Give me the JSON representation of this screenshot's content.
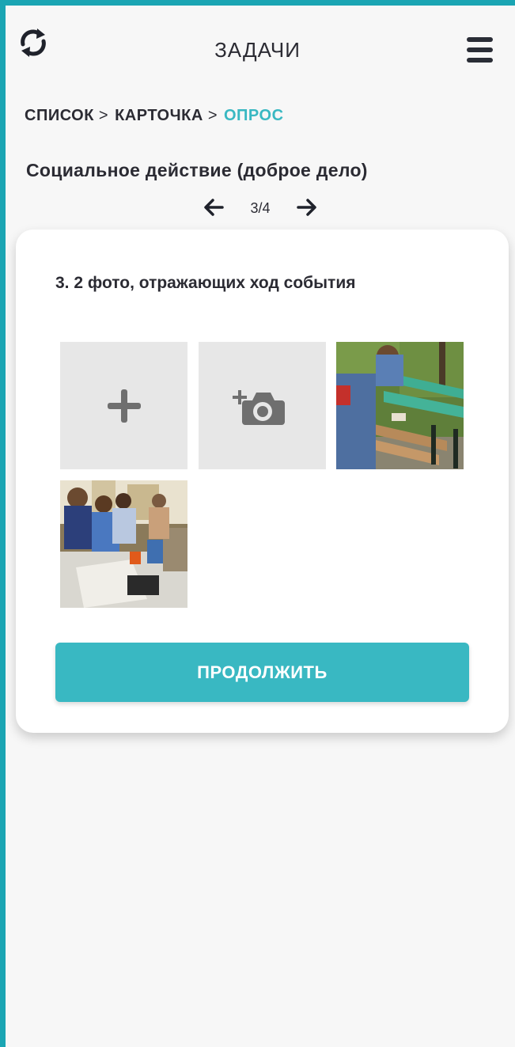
{
  "colors": {
    "accent": "#39b8c2",
    "frame": "#1aa5b3",
    "text": "#2b2b33",
    "background": "#f7f7f7"
  },
  "header": {
    "title": "ЗАДАЧИ",
    "sync_icon": "sync-icon",
    "menu_icon": "hamburger-icon"
  },
  "breadcrumb": {
    "items": [
      "СПИСОК",
      "КАРТОЧКА",
      "ОПРОС"
    ],
    "separator": ">"
  },
  "survey": {
    "title": "Социальное действие (доброе  дело)",
    "pager": "3/4"
  },
  "card": {
    "question": "3. 2 фото, отражающих ход события",
    "tiles": [
      {
        "type": "add",
        "icon": "plus-icon"
      },
      {
        "type": "camera",
        "icon": "add-photo-camera-icon"
      },
      {
        "type": "photo"
      },
      {
        "type": "photo"
      }
    ],
    "continue_label": "ПРОДОЛЖИТЬ"
  }
}
